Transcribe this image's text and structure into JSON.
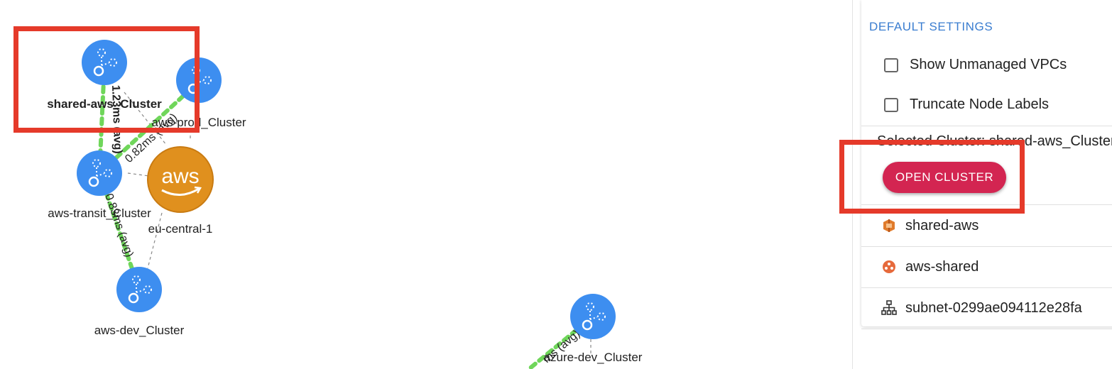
{
  "graph": {
    "nodes": [
      {
        "id": "shared-aws",
        "label": "shared-aws_Cluster",
        "kind": "cluster",
        "icon": "cluster-icon",
        "bold": true
      },
      {
        "id": "aws-prod",
        "label": "aws-prod_Cluster",
        "kind": "cluster",
        "icon": "cluster-icon"
      },
      {
        "id": "aws-transit",
        "label": "aws-transit_Cluster",
        "kind": "cluster",
        "icon": "cluster-icon"
      },
      {
        "id": "aws-dev",
        "label": "aws-dev_Cluster",
        "kind": "cluster",
        "icon": "cluster-icon"
      },
      {
        "id": "azure-dev",
        "label": "azure-dev_Cluster",
        "kind": "cluster",
        "icon": "cluster-icon"
      },
      {
        "id": "eu-central-1",
        "label": "eu-central-1",
        "kind": "region",
        "icon": "aws-logo-icon",
        "logo_text": "aws"
      }
    ],
    "edge_labels": {
      "shared_transit": "1.23ms (avg)",
      "prod_transit": "0.82ms (avg)",
      "transit_dev": "0.83ms (avg)",
      "azure_edge": "ms (avg)"
    },
    "colors": {
      "node": "#3d8ef0",
      "latency_edge": "#6fd65a",
      "aws_orange": "#e0901e"
    }
  },
  "panel": {
    "default_settings_heading": "DEFAULT SETTINGS",
    "show_unmanaged_vpcs": "Show Unmanaged VPCs",
    "truncate_node_labels": "Truncate Node Labels",
    "selected_cluster": "Selected Cluster: shared-aws_Cluster",
    "open_cluster_button": "OPEN CLUSTER",
    "items": [
      {
        "label": "shared-aws",
        "icon": "aws-account-icon"
      },
      {
        "label": "aws-shared",
        "icon": "aws-vpc-icon"
      },
      {
        "label": "subnet-0299ae094112e28fa",
        "icon": "subnet-hierarchy-icon"
      }
    ],
    "colors": {
      "heading": "#3a7dd0",
      "button": "#d32551",
      "highlight": "#e53a2a"
    }
  }
}
